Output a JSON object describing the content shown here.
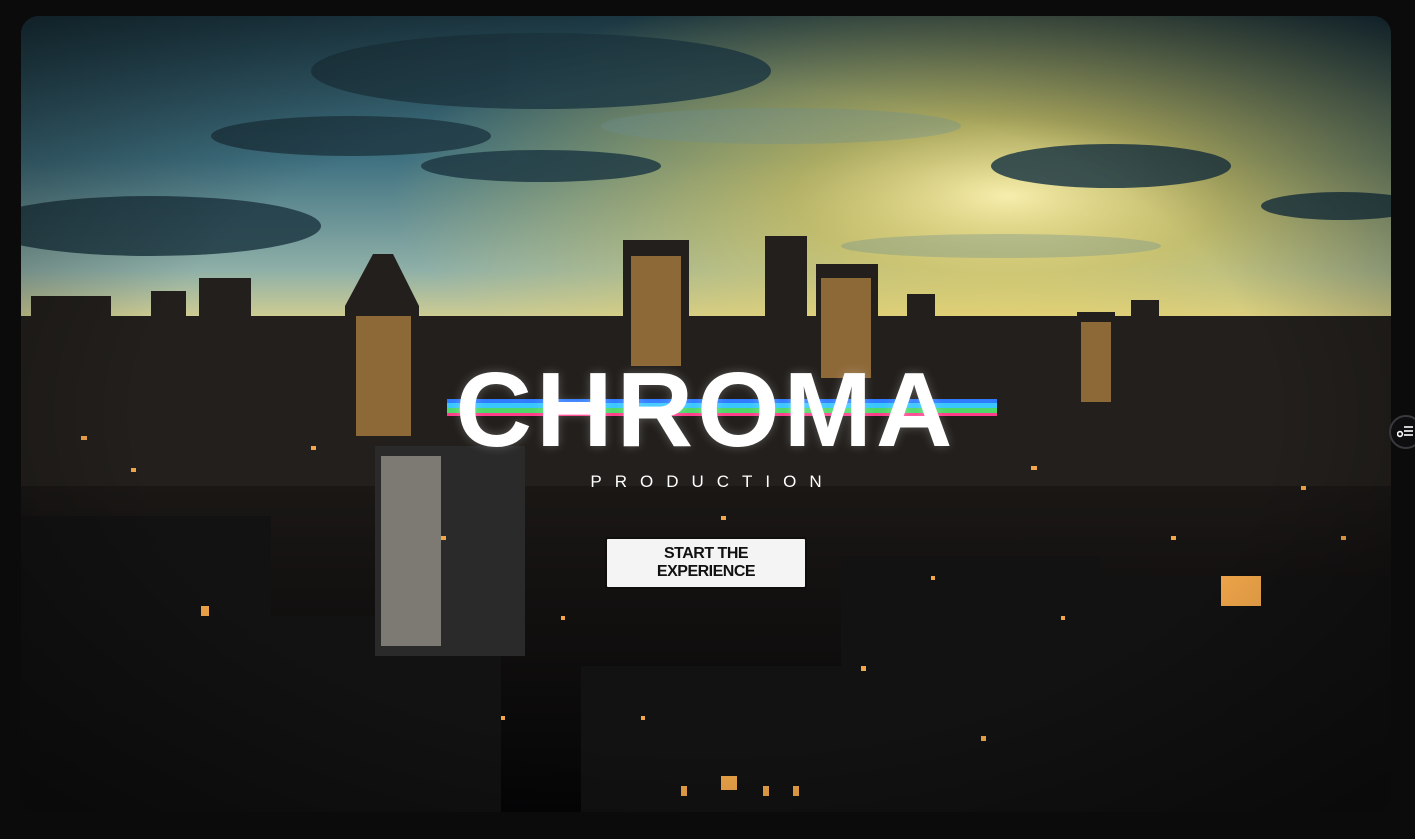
{
  "hero": {
    "brand": "CHROMA",
    "tagline": "PRODUCTION",
    "cta_label": "START THE EXPERIENCE"
  },
  "icons": {
    "side_button": "settings-sliders-icon"
  },
  "colors": {
    "page_background": "#0b0b0c",
    "cta_background": "#f4f4f4",
    "cta_text": "#111111",
    "stripe_blue": "#2f7bff",
    "stripe_cyan": "#39c6ff",
    "stripe_green": "#4fd86a",
    "stripe_pink": "#ff3d8a",
    "sky_gold": "#ffd23a",
    "sky_teal": "#2b5b66"
  }
}
